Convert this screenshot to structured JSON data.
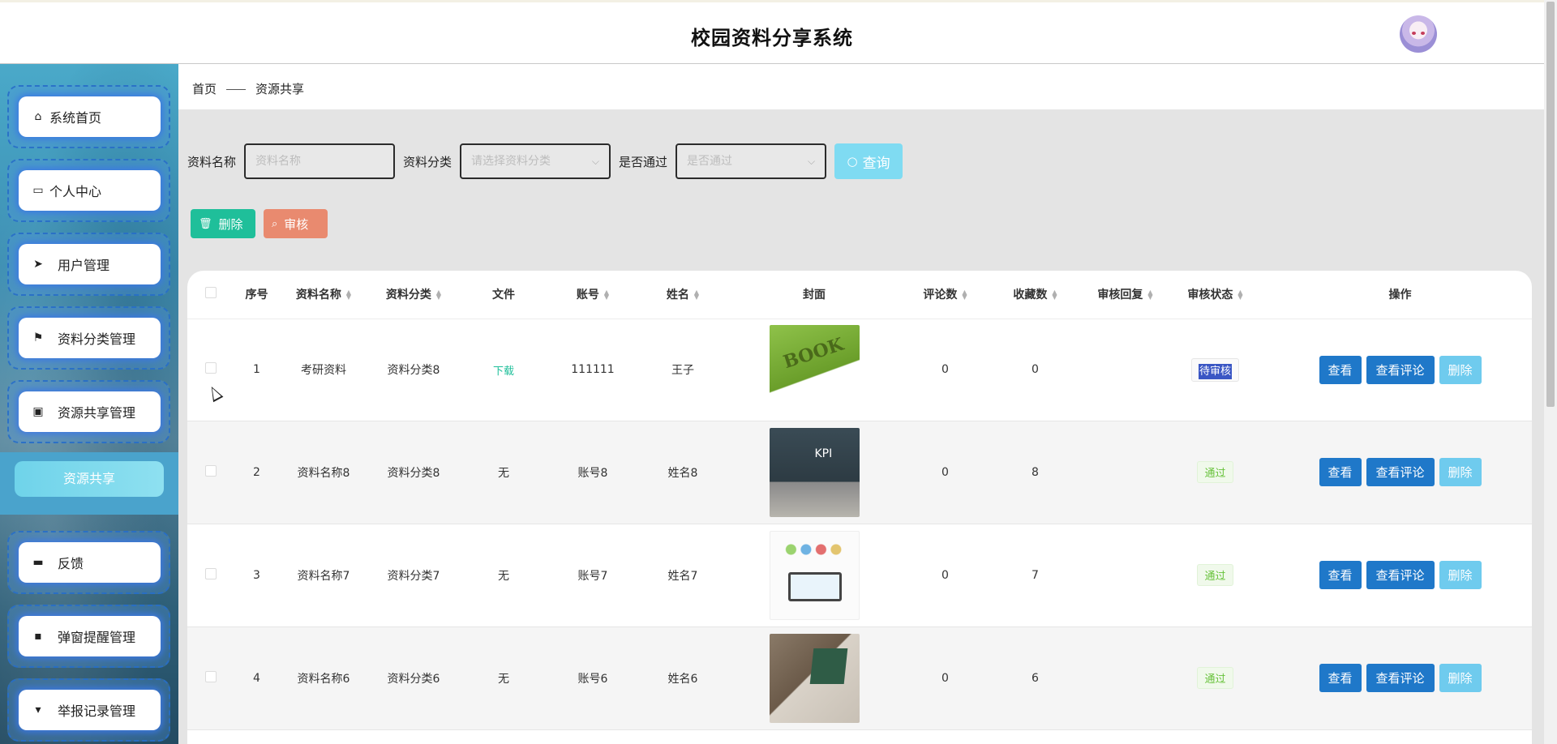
{
  "app": {
    "title": "校园资料分享系统",
    "avatar_alt": "user avatar"
  },
  "sidebar": {
    "items": [
      {
        "label": "系统首页",
        "icon": "home-icon"
      },
      {
        "label": "个人中心",
        "icon": "id-card-icon"
      },
      {
        "label": "用户管理",
        "icon": "paper-plane-icon"
      },
      {
        "label": "资料分类管理",
        "icon": "flag-icon"
      },
      {
        "label": "资源共享管理",
        "icon": "wallet-icon"
      },
      {
        "label": "反馈",
        "icon": "monitor-icon"
      },
      {
        "label": "弹窗提醒管理",
        "icon": "chat-icon"
      },
      {
        "label": "举报记录管理",
        "icon": "stamp-icon"
      }
    ],
    "active_sub": "资源共享"
  },
  "breadcrumb": {
    "home": "首页",
    "current": "资源共享"
  },
  "search": {
    "name_label": "资料名称",
    "name_placeholder": "资料名称",
    "category_label": "资料分类",
    "category_placeholder": "请选择资料分类",
    "passed_label": "是否通过",
    "passed_placeholder": "是否通过",
    "query_label": "查询"
  },
  "actions": {
    "delete_label": "删除",
    "review_label": "审核"
  },
  "table": {
    "headers": [
      "序号",
      "资料名称",
      "资料分类",
      "文件",
      "账号",
      "姓名",
      "封面",
      "评论数",
      "收藏数",
      "审核回复",
      "审核状态",
      "操作"
    ],
    "rows": [
      {
        "index": "1",
        "name": "考研资料",
        "category": "资料分类8",
        "file": "下载",
        "account": "111111",
        "person": "王子",
        "comments": "0",
        "favorites": "0",
        "reply": "",
        "status": "待审核"
      },
      {
        "index": "2",
        "name": "资料名称8",
        "category": "资料分类8",
        "file": "无",
        "account": "账号8",
        "person": "姓名8",
        "comments": "0",
        "favorites": "8",
        "reply": "",
        "status": "通过"
      },
      {
        "index": "3",
        "name": "资料名称7",
        "category": "资料分类7",
        "file": "无",
        "account": "账号7",
        "person": "姓名7",
        "comments": "0",
        "favorites": "7",
        "reply": "",
        "status": "通过"
      },
      {
        "index": "4",
        "name": "资料名称6",
        "category": "资料分类6",
        "file": "无",
        "account": "账号6",
        "person": "姓名6",
        "comments": "0",
        "favorites": "6",
        "reply": "",
        "status": "通过"
      }
    ],
    "covers": [
      "book-cover",
      "kpi-classroom-cover",
      "elearning-cover",
      "laptop-cover"
    ],
    "cover_texts": {
      "book": "BOOK",
      "kpi": "KPI"
    },
    "op_labels": {
      "view": "查看",
      "comments": "查看评论",
      "delete": "删除"
    }
  },
  "colors": {
    "accent_blue": "#1f78c9",
    "green": "#1fbf9a",
    "orange": "#e98a6f",
    "light_cyan": "#7fdbf2"
  }
}
